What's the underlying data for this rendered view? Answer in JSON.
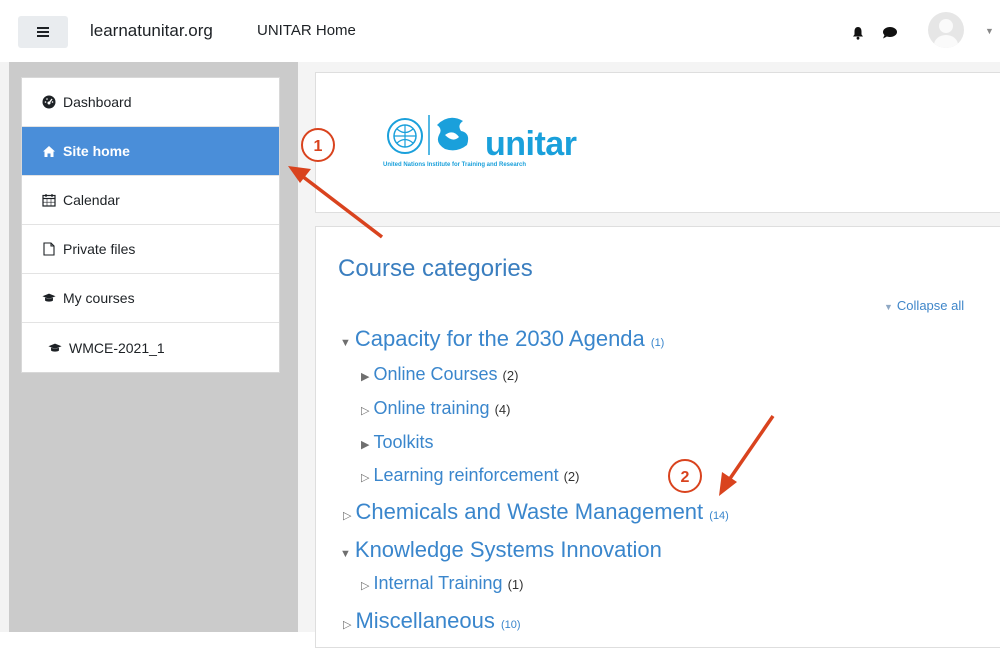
{
  "navbar": {
    "site_name": "learnatunitar.org",
    "home_link": "UNITAR Home",
    "menu_icon": "hamburger-icon",
    "notification_icon": "bell-icon",
    "message_icon": "chat-icon",
    "user_icon": "avatar-icon"
  },
  "sidebar": {
    "items": [
      {
        "label": "Dashboard",
        "icon": "dashboard-icon"
      },
      {
        "label": "Site home",
        "icon": "home-icon"
      },
      {
        "label": "Calendar",
        "icon": "calendar-icon"
      },
      {
        "label": "Private files",
        "icon": "file-icon"
      },
      {
        "label": "My courses",
        "icon": "graduation-cap-icon"
      },
      {
        "label": "WMCE-2021_1",
        "icon": "graduation-cap-icon"
      }
    ]
  },
  "logo": {
    "word": "unitar",
    "subtitle": "United Nations Institute for Training and Research"
  },
  "main": {
    "heading": "Course categories",
    "collapse_all": "Collapse all",
    "categories": [
      {
        "name": "Capacity for the 2030 Agenda",
        "count": "(1)",
        "expanded": true,
        "children": [
          {
            "name": "Online Courses",
            "count": "(2)"
          },
          {
            "name": "Online training",
            "count": "(4)"
          },
          {
            "name": "Toolkits",
            "count": ""
          },
          {
            "name": "Learning reinforcement",
            "count": "(2)"
          }
        ]
      },
      {
        "name": "Chemicals and Waste Management",
        "count": "(14)",
        "expanded": false
      },
      {
        "name": "Knowledge Systems Innovation",
        "count": "",
        "expanded": true,
        "children": [
          {
            "name": "Internal Training",
            "count": "(1)"
          }
        ]
      },
      {
        "name": "Miscellaneous",
        "count": "(10)",
        "expanded": false
      }
    ]
  },
  "annotations": {
    "badge1": "1",
    "badge2": "2",
    "color": "#d9431e"
  }
}
